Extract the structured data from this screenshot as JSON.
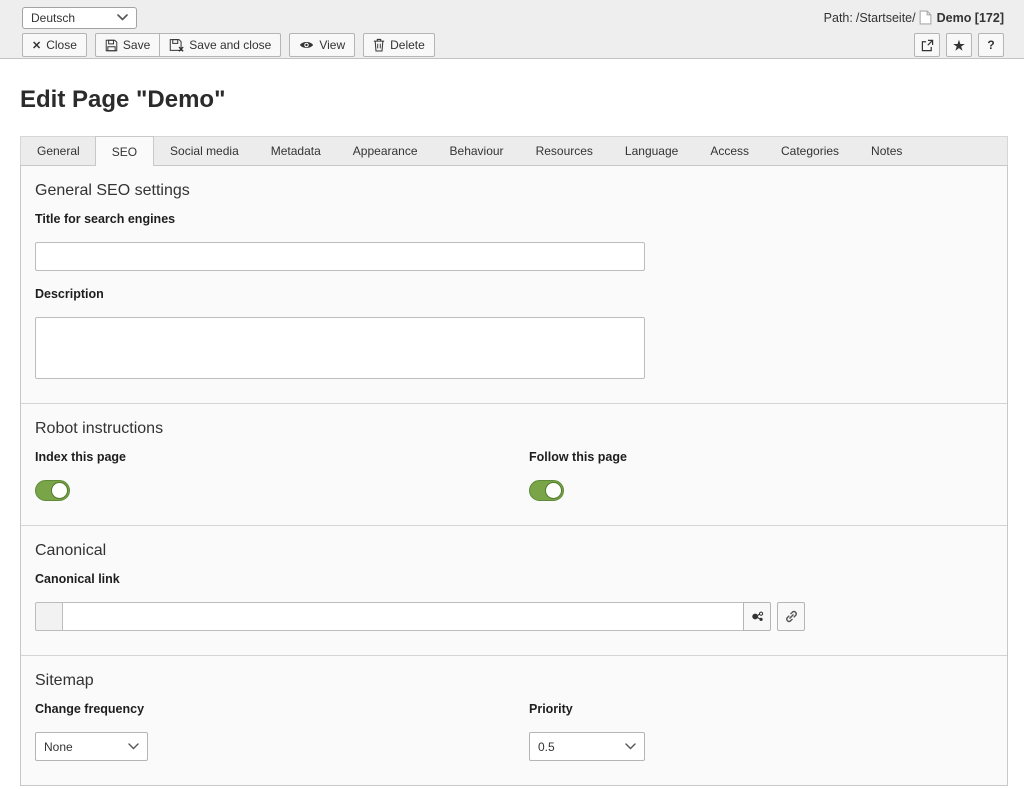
{
  "docheader": {
    "language_select": {
      "value": "Deutsch"
    },
    "path": {
      "label": "Path:",
      "value": "/Startseite/",
      "record_title": "Demo [172]",
      "record_icon": "page-document-icon"
    },
    "buttons": {
      "close": "Close",
      "save": "Save",
      "save_and_close": "Save and close",
      "view": "View",
      "delete": "Delete",
      "close_icon": "x-close-icon",
      "save_icon": "floppy-disk-icon",
      "save_close_icon": "floppy-disk-x-icon",
      "view_icon": "eye-icon",
      "delete_icon": "trash-icon"
    },
    "icon_buttons": {
      "open_new_window_icon": "open-in-new-window-icon",
      "bookmark_icon": "star-icon",
      "bookmark_glyph": "★",
      "help_label": "?"
    }
  },
  "page_title": "Edit Page \"Demo\"",
  "tabs": [
    {
      "label": "General",
      "active": false
    },
    {
      "label": "SEO",
      "active": true
    },
    {
      "label": "Social media",
      "active": false
    },
    {
      "label": "Metadata",
      "active": false
    },
    {
      "label": "Appearance",
      "active": false
    },
    {
      "label": "Behaviour",
      "active": false
    },
    {
      "label": "Resources",
      "active": false
    },
    {
      "label": "Language",
      "active": false
    },
    {
      "label": "Access",
      "active": false
    },
    {
      "label": "Categories",
      "active": false
    },
    {
      "label": "Notes",
      "active": false
    }
  ],
  "sections": {
    "general_seo": {
      "heading": "General SEO settings",
      "title_label": "Title for search engines",
      "title_value": "",
      "description_label": "Description",
      "description_value": ""
    },
    "robots": {
      "heading": "Robot instructions",
      "index_label": "Index this page",
      "index_enabled": true,
      "follow_label": "Follow this page",
      "follow_enabled": true
    },
    "canonical": {
      "heading": "Canonical",
      "link_label": "Canonical link",
      "link_value": "",
      "record_browser_icon": "record-browser-icon",
      "link_browser_icon": "link-chain-icon"
    },
    "sitemap": {
      "heading": "Sitemap",
      "change_frequency_label": "Change frequency",
      "change_frequency_value": "None",
      "priority_label": "Priority",
      "priority_value": "0.5"
    }
  },
  "colors": {
    "toggle_on": "#79a548",
    "docheader_bg": "#eeeeee",
    "panel_bg": "#fafafa",
    "tabbar_bg": "#ececec"
  }
}
